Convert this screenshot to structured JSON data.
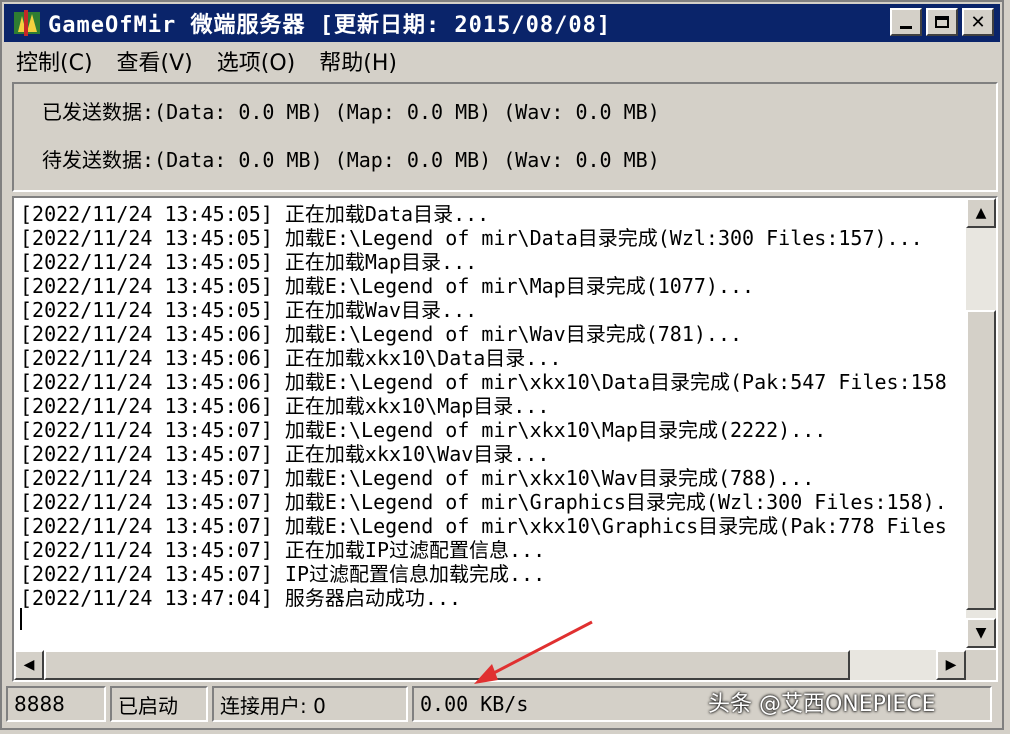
{
  "window": {
    "title": "GameOfMir 微端服务器 [更新日期: 2015/08/08]"
  },
  "menu": [
    {
      "label": "控制(C)"
    },
    {
      "label": "查看(V)"
    },
    {
      "label": "选项(O)"
    },
    {
      "label": "帮助(H)"
    }
  ],
  "stats": {
    "sent": "已发送数据:(Data: 0.0 MB) (Map: 0.0 MB) (Wav: 0.0 MB)",
    "pending": "待发送数据:(Data: 0.0 MB) (Map: 0.0 MB) (Wav: 0.0 MB)"
  },
  "log": [
    "[2022/11/24 13:45:05] 正在加载Data目录...",
    "[2022/11/24 13:45:05] 加载E:\\Legend of mir\\Data目录完成(Wzl:300 Files:157)...",
    "[2022/11/24 13:45:05] 正在加载Map目录...",
    "[2022/11/24 13:45:05] 加载E:\\Legend of mir\\Map目录完成(1077)...",
    "[2022/11/24 13:45:05] 正在加载Wav目录...",
    "[2022/11/24 13:45:06] 加载E:\\Legend of mir\\Wav目录完成(781)...",
    "[2022/11/24 13:45:06] 正在加载xkx10\\Data目录...",
    "[2022/11/24 13:45:06] 加载E:\\Legend of mir\\xkx10\\Data目录完成(Pak:547 Files:158",
    "[2022/11/24 13:45:06] 正在加载xkx10\\Map目录...",
    "[2022/11/24 13:45:07] 加载E:\\Legend of mir\\xkx10\\Map目录完成(2222)...",
    "[2022/11/24 13:45:07] 正在加载xkx10\\Wav目录...",
    "[2022/11/24 13:45:07] 加载E:\\Legend of mir\\xkx10\\Wav目录完成(788)...",
    "[2022/11/24 13:45:07] 加载E:\\Legend of mir\\Graphics目录完成(Wzl:300 Files:158).",
    "[2022/11/24 13:45:07] 加载E:\\Legend of mir\\xkx10\\Graphics目录完成(Pak:778 Files",
    "[2022/11/24 13:45:07] 正在加载IP过滤配置信息...",
    "[2022/11/24 13:45:07] IP过滤配置信息加载完成...",
    "[2022/11/24 13:47:04] 服务器启动成功..."
  ],
  "status": {
    "port": "8888",
    "state": "已启动",
    "users": "连接用户: 0",
    "speed": "0.00 KB/s"
  },
  "watermark": "头条 @艾西ONEPIECE",
  "colors": {
    "titlebar": "#0a246a",
    "face": "#d4d0c8",
    "annotation_arrow": "#e03030"
  }
}
